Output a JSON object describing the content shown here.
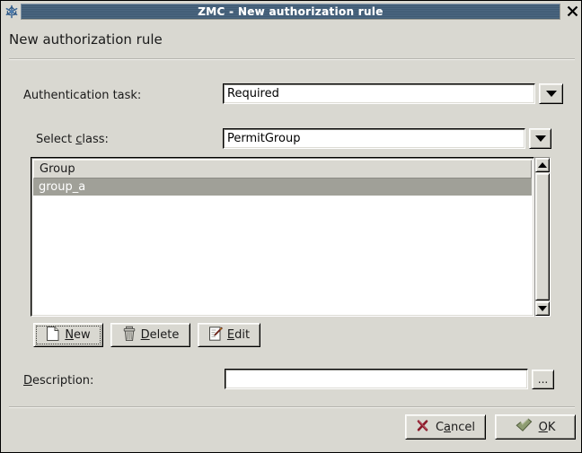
{
  "window": {
    "title": "ZMC - New authorization rule",
    "app_icon": "snowflake-icon",
    "close_label": "✕"
  },
  "heading": "New authorization rule",
  "form": {
    "auth_task": {
      "label": "Authentication task:",
      "value": "Required",
      "dropdown_icon": "chevron-down-icon"
    },
    "select_class": {
      "label_prefix": "Select ",
      "label_accel": "c",
      "label_suffix": "lass:",
      "value": "PermitGroup",
      "dropdown_icon": "chevron-down-icon"
    },
    "description": {
      "label_accel": "D",
      "label_suffix": "escription:",
      "value": "",
      "placeholder": "",
      "browse_label": "..."
    }
  },
  "list": {
    "columns": [
      "Group"
    ],
    "rows": [
      {
        "group": "group_a",
        "selected": true
      }
    ],
    "scrollbar": {
      "up_icon": "arrow-up-icon",
      "down_icon": "arrow-down-icon"
    }
  },
  "actions": [
    {
      "label_accel": "N",
      "label_suffix": "ew",
      "icon": "new-document-icon",
      "focused": true
    },
    {
      "label_accel": "D",
      "label_suffix": "elete",
      "icon": "trash-can-icon",
      "focused": false
    },
    {
      "label_accel": "E",
      "label_suffix": "dit",
      "icon": "edit-pencil-icon",
      "focused": false
    }
  ],
  "footer": {
    "cancel": {
      "label_prefix": "C",
      "label_accel": "a",
      "label_suffix": "ncel",
      "icon": "red-x-icon"
    },
    "ok": {
      "label_accel": "O",
      "label_suffix": "K",
      "icon": "green-check-icon"
    }
  },
  "colors": {
    "face": "#d9d8d1",
    "titlebar": "#46617b",
    "title_text": "#ffffff",
    "selection": "#a0a098",
    "cancel_icon": "#8b1a2b",
    "ok_icon": "#7a8a5e",
    "text": "#1a1a1a"
  }
}
